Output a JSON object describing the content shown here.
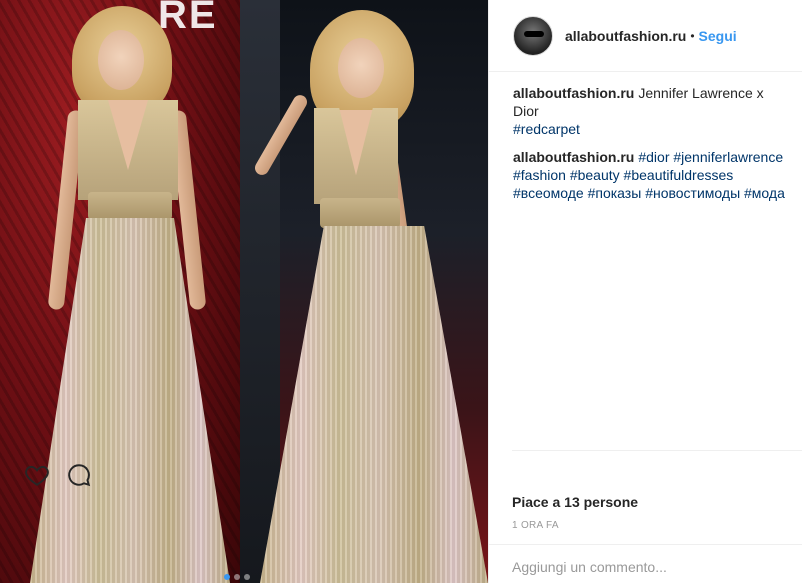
{
  "post": {
    "username": "allaboutfashion.ru",
    "separator": "•",
    "follow_label": "Segui",
    "logo_letters": "RE"
  },
  "comments": [
    {
      "author": "allaboutfashion.ru",
      "text": "Jennifer Lawrence x Dior",
      "tags": [
        "#redcarpet"
      ]
    },
    {
      "author": "allaboutfashion.ru",
      "tags": [
        "#dior",
        "#jenniferlawrence",
        "#fashion",
        "#beauty",
        "#beautifuldresses",
        "#всеомоде",
        "#показы",
        "#новостимоды",
        "#мода"
      ]
    }
  ],
  "actions": {
    "like_icon": "heart-icon",
    "comment_icon": "comment-bubble-icon"
  },
  "likes_text": "Piace a 13 persone",
  "timestamp": "1 ORA FA",
  "add_comment_placeholder": "Aggiungi un commento...",
  "carousel": {
    "count": 3,
    "active_index": 0
  },
  "colors": {
    "accent": "#3897f0",
    "text": "#262626",
    "muted": "#999999",
    "tag": "#003569"
  }
}
